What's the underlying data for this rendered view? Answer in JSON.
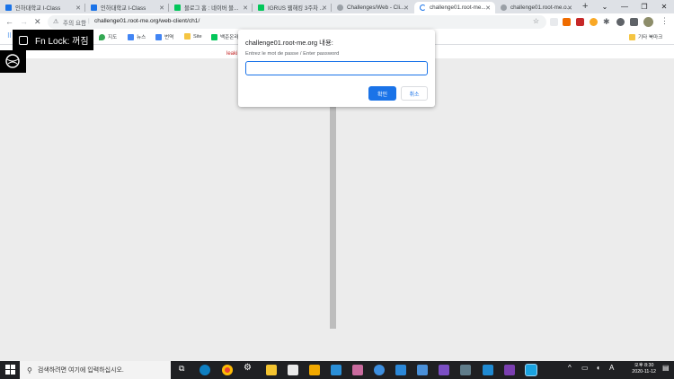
{
  "browser": {
    "tabs": [
      {
        "label": "인하대학교 I-Class",
        "fav_color": "#1a73e8",
        "active": false
      },
      {
        "label": "인하대학교 I-Class",
        "fav_color": "#1a73e8",
        "active": false
      },
      {
        "label": "블로그 홈 : 네이버 블...",
        "fav_color": "#03c75a",
        "active": false
      },
      {
        "label": "IGRUS 웹해킹 3주차 ...",
        "fav_color": "#03c75a",
        "active": false
      },
      {
        "label": "Challenges/Web - Cli...",
        "fav_color": "#9aa0a6",
        "active": false
      },
      {
        "label": "challenge01.root-me...",
        "fav_color": "#1a73e8",
        "active": true
      },
      {
        "label": "challenge01.root-me.o...",
        "fav_color": "#9aa0a6",
        "active": false
      }
    ],
    "new_tab_label": "+",
    "window_controls": [
      "⌄",
      "—",
      "❐",
      "✕"
    ],
    "security_label": "주의 요함",
    "url": "challenge01.root-me.org/web-client/ch1/",
    "bookmarks": [
      {
        "label": "",
        "icon": "apps-grid-icon"
      },
      {
        "label": "지도",
        "icon": "maps-icon"
      },
      {
        "label": "뉴스",
        "icon": "news-icon"
      },
      {
        "label": "번역",
        "icon": "translate-icon"
      },
      {
        "label": "Site",
        "icon": "folder-icon"
      },
      {
        "label": "백준온라",
        "icon": "bookmark-icon"
      }
    ],
    "other_bookmarks": "기타 북마크"
  },
  "page": {
    "partial_text": "leaki"
  },
  "fn_lock": {
    "text": "Fn Lock: 꺼짐"
  },
  "dialog": {
    "title": "challenge01.root-me.org 내용:",
    "message": "Entrez le mot de passe / Enter password",
    "input_value": "",
    "ok_label": "확인",
    "cancel_label": "취소"
  },
  "taskbar": {
    "search_placeholder": "검색하려면 여기에 입력하십시오.",
    "clock_time": "오후 8:30",
    "clock_date": "2020-11-12"
  },
  "colors": {
    "accent": "#1a73e8",
    "tabstrip": "#dee1e6",
    "page_bg": "#ececec",
    "taskbar": "#1f2023"
  }
}
